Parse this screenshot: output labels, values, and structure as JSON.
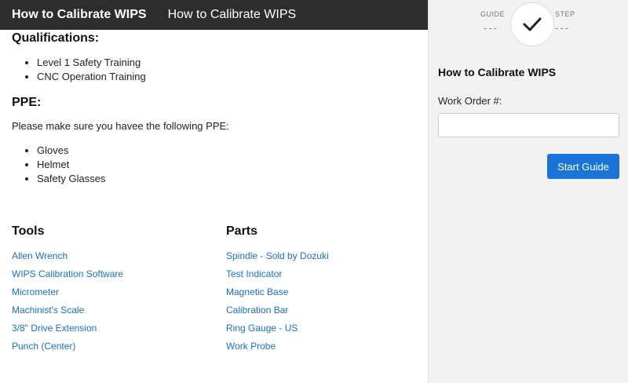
{
  "header": {
    "title_bold": "How to Calibrate WIPS",
    "title_regular": "How to Calibrate WIPS"
  },
  "qualifications": {
    "title": "Qualifications:",
    "items": [
      "Level 1 Safety Training",
      "CNC Operation Training"
    ]
  },
  "ppe": {
    "title": "PPE:",
    "text": "Please make sure you havee the following PPE:",
    "items": [
      "Gloves",
      "Helmet",
      "Safety Glasses"
    ]
  },
  "tools": {
    "title": "Tools",
    "items": [
      "Allen Wrench",
      "WIPS Calibration Software",
      "Micrometer",
      "Machinist's Scale",
      "3/8\" Drive Extension",
      "Punch (Center)"
    ]
  },
  "parts": {
    "title": "Parts",
    "items": [
      "Spindle - Sold by Dozuki",
      "Test Indicator",
      "Magnetic Base",
      "Calibration Bar",
      "Ring Gauge - US",
      "Work Probe"
    ]
  },
  "sidebar": {
    "guide_label": "GUIDE",
    "guide_value": "---",
    "step_label": "STEP",
    "step_value": "---",
    "check_icon": "checkmark-icon",
    "title": "How to Calibrate WIPS",
    "work_order_label": "Work Order #:",
    "work_order_value": "",
    "start_button": "Start Guide"
  },
  "colors": {
    "header_bg": "#2d2d2d",
    "link": "#1a6fd1",
    "button": "#1a74d8",
    "sidebar_bg": "#f2f2f2"
  }
}
